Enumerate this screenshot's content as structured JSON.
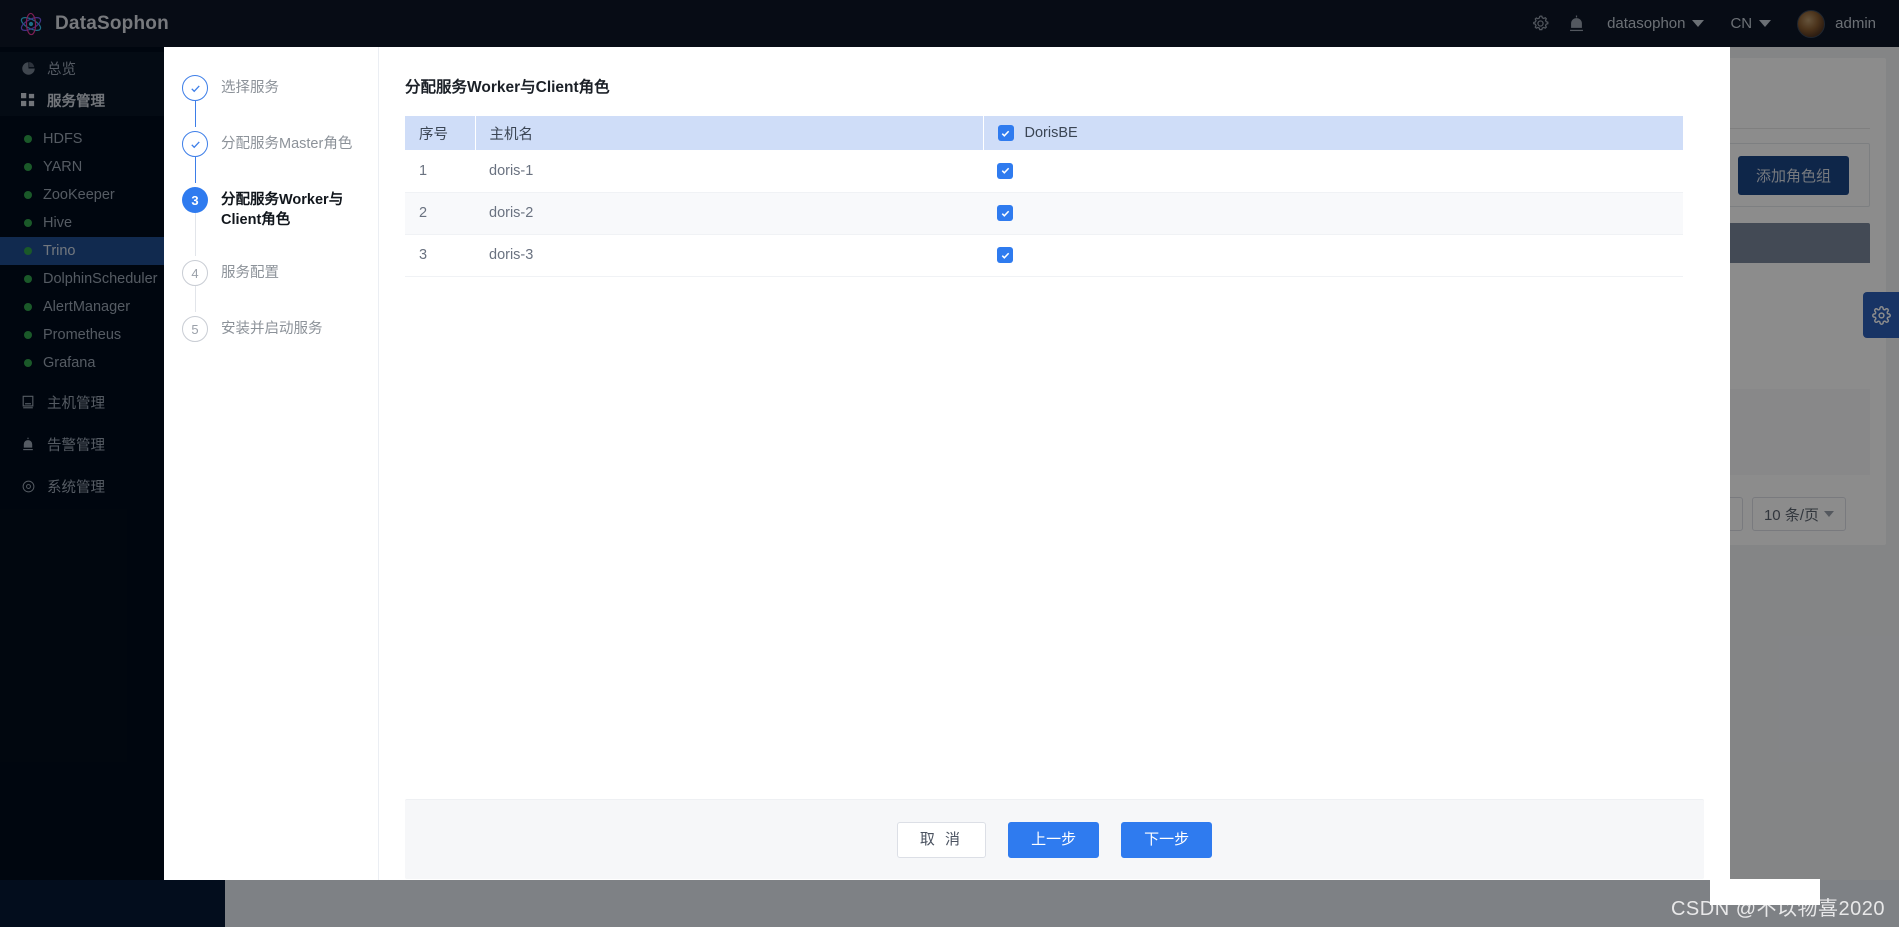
{
  "header": {
    "brand": "DataSophon",
    "logo_icon": "atom-icon",
    "settings_icon": "gear-icon",
    "alarm_icon": "bell-alarm-icon",
    "cluster": "datasophon",
    "language": "CN",
    "user": "admin",
    "avatar_icon": "avatar"
  },
  "sidebar": {
    "items": [
      {
        "label": "总览",
        "icon": "dashboard-icon",
        "type": "menu",
        "state": "normal"
      },
      {
        "label": "服务管理",
        "icon": "grid-icon",
        "type": "menu",
        "state": "section"
      },
      {
        "label": "HDFS",
        "icon": "status-dot",
        "type": "service",
        "state": "normal"
      },
      {
        "label": "YARN",
        "icon": "status-dot",
        "type": "service",
        "state": "normal"
      },
      {
        "label": "ZooKeeper",
        "icon": "status-dot",
        "type": "service",
        "state": "normal"
      },
      {
        "label": "Hive",
        "icon": "status-dot",
        "type": "service",
        "state": "normal"
      },
      {
        "label": "Trino",
        "icon": "status-dot",
        "type": "service",
        "state": "selected"
      },
      {
        "label": "DolphinScheduler",
        "icon": "status-dot",
        "type": "service",
        "state": "normal"
      },
      {
        "label": "AlertManager",
        "icon": "status-dot",
        "type": "service",
        "state": "normal"
      },
      {
        "label": "Prometheus",
        "icon": "status-dot",
        "type": "service",
        "state": "normal"
      },
      {
        "label": "Grafana",
        "icon": "status-dot",
        "type": "service",
        "state": "normal"
      },
      {
        "label": "主机管理",
        "icon": "server-icon",
        "type": "menu",
        "state": "normal"
      },
      {
        "label": "告警管理",
        "icon": "bell-alarm-icon",
        "type": "menu",
        "state": "normal"
      },
      {
        "label": "系统管理",
        "icon": "gear-icon",
        "type": "menu",
        "state": "normal"
      }
    ]
  },
  "background_page": {
    "add_role_group_button": "添加角色组",
    "pagination": {
      "next_label": "›",
      "page_size": "10 条/页"
    },
    "side_gear_icon": "gear-icon"
  },
  "modal": {
    "steps": [
      {
        "num": "1",
        "label": "选择服务",
        "state": "done",
        "icon": "check-icon"
      },
      {
        "num": "2",
        "label": "分配服务Master角色",
        "state": "done",
        "icon": "check-icon"
      },
      {
        "num": "3",
        "label": "分配服务Worker与Client角色",
        "state": "active",
        "icon": "step-number"
      },
      {
        "num": "4",
        "label": "服务配置",
        "state": "todo",
        "icon": "step-number"
      },
      {
        "num": "5",
        "label": "安装并启动服务",
        "state": "todo",
        "icon": "step-number"
      }
    ],
    "title": "分配服务Worker与Client角色",
    "table": {
      "columns": [
        "序号",
        "主机名",
        "DorisBE"
      ],
      "header_checkbox_checked": true,
      "rows": [
        {
          "index": "1",
          "host": "doris-1",
          "checked": true
        },
        {
          "index": "2",
          "host": "doris-2",
          "checked": true
        },
        {
          "index": "3",
          "host": "doris-3",
          "checked": true
        }
      ]
    },
    "footer": {
      "cancel": "取 消",
      "prev": "上一步",
      "next": "下一步"
    }
  },
  "watermark": "CSDN @不以物喜2020",
  "colors": {
    "accent": "#2f7bef",
    "sidebar_bg": "#010c1c",
    "header_bg": "#0d1627",
    "selected_nav": "#1f4e91",
    "table_header": "#cfddf8",
    "status_dot": "#31a24c"
  }
}
